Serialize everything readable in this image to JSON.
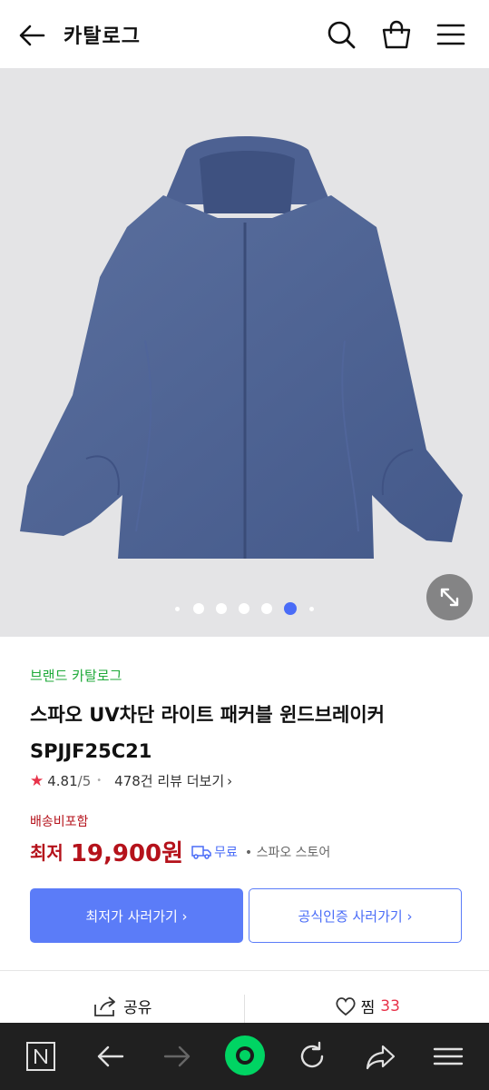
{
  "header": {
    "title": "카탈로그"
  },
  "gallery": {
    "image_alt": "blue hooded windbreaker jacket",
    "dot_count": 6,
    "active_index": 5
  },
  "product": {
    "brand_link": "브랜드 카탈로그",
    "name": "스파오 UV차단 라이트 패커블 윈드브레이커 SPJJF25C21",
    "rating": "4.81",
    "rating_max": "/5",
    "review_count": "478건 리뷰 더보기",
    "shipping_note": "배송비포함",
    "price_label": "최저",
    "price": "19,900원",
    "shipping": "무료",
    "store": "스파오 스토어"
  },
  "buttons": {
    "lowest_buy": "최저가 사러가기 ›",
    "official_buy": "공식인증 사러가기 ›"
  },
  "actions": {
    "share": "공유",
    "zzim": "찜",
    "zzim_count": "33"
  },
  "colors": {
    "accent_blue": "#5b7cf8",
    "price_red": "#b5121b",
    "brand_green": "#1faa3a",
    "active_dot": "#4a6cf7",
    "nav_bg": "#202020",
    "nav_green": "#00d463"
  },
  "icons": {
    "back": "arrow-left-icon",
    "search": "search-icon",
    "cart": "shopping-bag-icon",
    "menu": "hamburger-icon",
    "zoom": "expand-icon",
    "star": "star-icon",
    "truck": "truck-icon",
    "share": "share-icon",
    "heart": "heart-icon",
    "nav_home": "naver-n-icon",
    "nav_back": "arrow-left-icon",
    "nav_forward": "arrow-right-icon",
    "nav_green": "green-dot-icon",
    "nav_refresh": "refresh-icon",
    "nav_share": "share-arrow-icon",
    "nav_menu": "hamburger-icon"
  }
}
